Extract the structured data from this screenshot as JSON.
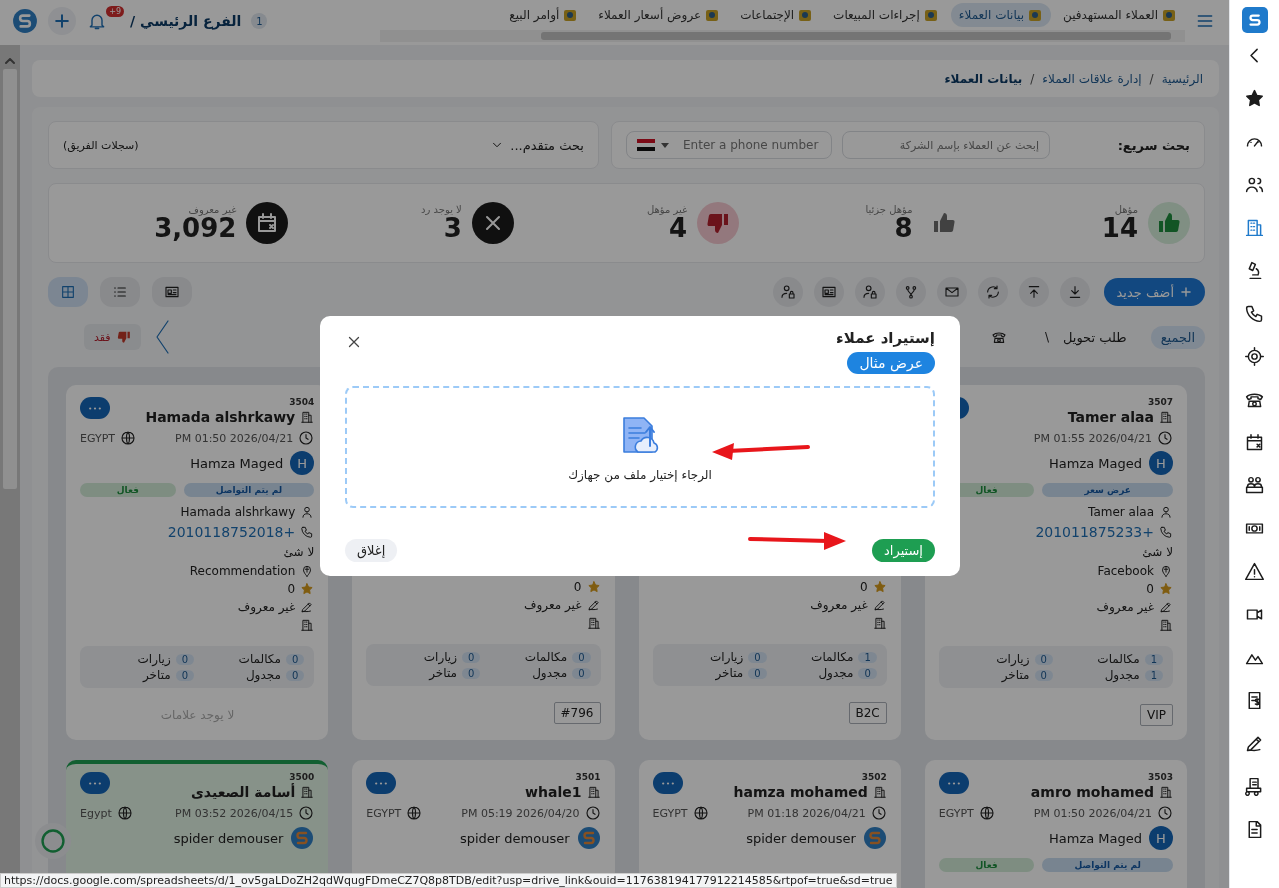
{
  "topbar": {
    "tabs": [
      {
        "label": "العملاء المستهدفين",
        "selected": false
      },
      {
        "label": "بيانات العملاء",
        "selected": true
      },
      {
        "label": "إجراءات المبيعات",
        "selected": false
      },
      {
        "label": "الإجتماعات",
        "selected": false
      },
      {
        "label": "عروض أسعار العملاء",
        "selected": false
      },
      {
        "label": "أوامر البيع",
        "selected": false
      }
    ],
    "branch": {
      "label": "الفرع الرئيسي /",
      "count": "1"
    },
    "notifications": {
      "badge": "+9"
    }
  },
  "sidebar": {
    "items": [
      {
        "selected": false
      },
      {
        "selected": false
      },
      {
        "selected": false
      },
      {
        "selected": true
      },
      {
        "selected": false
      },
      {
        "selected": false
      },
      {
        "selected": false
      },
      {
        "selected": false
      },
      {
        "selected": false
      },
      {
        "selected": false
      },
      {
        "selected": false
      },
      {
        "selected": false
      },
      {
        "selected": false
      },
      {
        "selected": false
      },
      {
        "selected": false
      },
      {
        "selected": false
      },
      {
        "selected": false
      },
      {
        "selected": false
      }
    ]
  },
  "breadcrumb": {
    "separator": "/",
    "items": [
      {
        "label": "الرئيسية",
        "current": false
      },
      {
        "label": "إدارة علاقات العملاء",
        "current": false
      },
      {
        "label": "بيانات العملاء",
        "current": true
      }
    ]
  },
  "search": {
    "label": "بحث سريع:",
    "company_placeholder": "إبحث عن العملاء بإسم الشركة",
    "phone_placeholder": "Enter a phone number",
    "advanced": "بحث متقدم...",
    "team_records": "(سجلات الفريق)"
  },
  "stats": [
    {
      "kind": "up",
      "label": "مؤهل",
      "value": "14"
    },
    {
      "kind": "partial",
      "label": "مؤهل جزئيا",
      "value": "8"
    },
    {
      "kind": "down",
      "label": "غير مؤهل",
      "value": "4"
    },
    {
      "kind": "none",
      "label": "لا يوجد رد",
      "value": "3"
    },
    {
      "kind": "unknown",
      "label": "غير معروف",
      "value": "3,092"
    }
  ],
  "toolbar": {
    "add_button": "أضف جديد",
    "views": [
      {
        "selected": false
      },
      {
        "selected": false
      },
      {
        "selected": true
      }
    ]
  },
  "filters": [
    {
      "label": "الجميع",
      "selected": true
    },
    {
      "label": "طلب تحويل",
      "count": "\\",
      "selected": false
    }
  ],
  "lost_filter": {
    "label": "فقد",
    "selected": false
  },
  "cards": [
    {
      "id": "3507",
      "name": "Tamer alaa",
      "date": "PM 01:55 2026/04/21",
      "owner": {
        "kind": "letter",
        "avatar": "H",
        "name": "Hamza Maged"
      },
      "tags": [
        {
          "label": "عرض سعر",
          "kind": "stage"
        },
        {
          "label": "فعال",
          "kind": "active"
        }
      ],
      "contact": "Tamer alaa",
      "phone": "201011875233+",
      "note": "لا شئ",
      "source": "Facebook",
      "rating": "0",
      "budget": "غير معروف",
      "stats": [
        {
          "label": "مكالمات",
          "count": "1"
        },
        {
          "label": "زيارات",
          "count": "0"
        },
        {
          "label": "مجدول",
          "count": "1"
        },
        {
          "label": "متاخر",
          "count": "0"
        }
      ],
      "label": "VIP",
      "highlighted": false
    },
    {
      "rating": "0",
      "budget": "غير معروف",
      "stats": [
        {
          "label": "مكالمات",
          "count": "1"
        },
        {
          "label": "زيارات",
          "count": "0"
        },
        {
          "label": "مجدول",
          "count": "0"
        },
        {
          "label": "متاخر",
          "count": "0"
        }
      ],
      "label": "B2C",
      "highlighted": false
    },
    {
      "rating": "0",
      "budget": "غير معروف",
      "stats": [
        {
          "label": "مكالمات",
          "count": "0"
        },
        {
          "label": "زيارات",
          "count": "0"
        },
        {
          "label": "مجدول",
          "count": "0"
        },
        {
          "label": "متاخر",
          "count": "0"
        }
      ],
      "label": "#796",
      "highlighted": false
    },
    {
      "id": "3504",
      "name": "Hamada alshrkawy",
      "date": "PM 01:50 2026/04/21",
      "country": "EGYPT",
      "owner": {
        "kind": "letter",
        "avatar": "H",
        "name": "Hamza Maged"
      },
      "tags": [
        {
          "label": "لم يتم التواصل",
          "kind": "stage"
        },
        {
          "label": "فعال",
          "kind": "active"
        }
      ],
      "contact": "Hamada alshrkawy",
      "phone": "2010118752018+",
      "note": "لا شئ",
      "source": "Recommendation",
      "rating": "0",
      "budget": "غير معروف",
      "stats": [
        {
          "label": "مكالمات",
          "count": "0"
        },
        {
          "label": "زيارات",
          "count": "0"
        },
        {
          "label": "مجدول",
          "count": "0"
        },
        {
          "label": "متاخر",
          "count": "0"
        }
      ],
      "no_label": "لا يوجد علامات",
      "highlighted": false
    },
    {
      "id": "3503",
      "name": "amro mohamed",
      "date": "PM 01:50 2026/04/21",
      "country": "EGYPT",
      "owner": {
        "kind": "letter",
        "avatar": "H",
        "name": "Hamza Maged"
      },
      "tags": [
        {
          "label": "لم يتم التواصل",
          "kind": "stage"
        },
        {
          "label": "فعال",
          "kind": "active"
        }
      ],
      "highlighted": false
    },
    {
      "id": "3502",
      "name": "hamza mohamed",
      "date": "PM 01:18 2026/04/21",
      "country": "EGYPT",
      "owner": {
        "kind": "logo",
        "name": "spider demouser"
      },
      "highlighted": false
    },
    {
      "id": "3501",
      "name": "whale1",
      "date": "PM 05:19 2026/04/20",
      "country": "EGYPT",
      "owner": {
        "kind": "logo",
        "name": "spider demouser"
      },
      "highlighted": false
    },
    {
      "id": "3500",
      "name": "أسامة الصعيدى",
      "date": "PM 03:52 2026/04/15",
      "country": "Egypt",
      "owner": {
        "kind": "logo",
        "name": "spider demouser"
      },
      "highlighted": true
    }
  ],
  "modal": {
    "title": "إستيراد عملاء",
    "example_button": "عرض مثال",
    "dropzone_text": "الرجاء إختيار ملف من جهازك",
    "import_button": "إستيراد",
    "close_button": "إغلاق"
  },
  "status_url": "https://docs.google.com/spreadsheets/d/1_ov5gaLDoZH2qdWqugFDmeCZ7Q8p8TDB/edit?usp=drive_link&ouid=117638194177912214585&rtpof=true&sd=true"
}
